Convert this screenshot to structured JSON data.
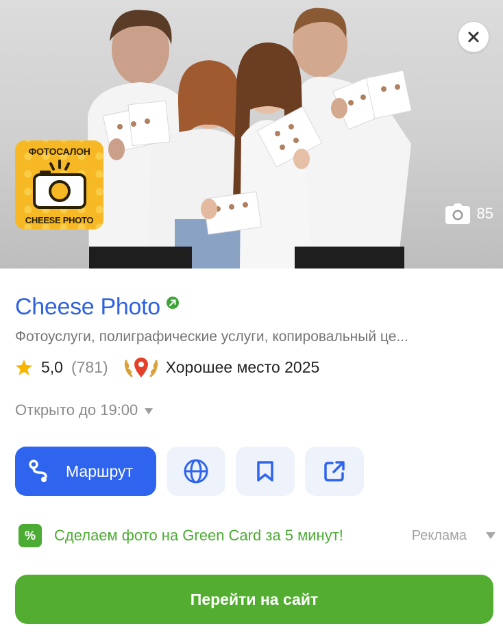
{
  "hero": {
    "logo": {
      "top_text": "ФОТОСАЛОН",
      "bottom_text": "CHEESE PHOTO",
      "color": "#f6b925"
    },
    "photo_count": "85",
    "close_icon": "close-icon",
    "camera_icon": "camera-icon"
  },
  "place": {
    "name": "Cheese Photo",
    "categories": "Фотоуслуги, полиграфические услуги, копировальный це...",
    "rating": "5,0",
    "reviews": "(781)",
    "award": "Хорошее место 2025",
    "hours": "Открыто до 19:00"
  },
  "actions": {
    "route_label": "Маршрут",
    "icons": [
      "globe-icon",
      "bookmark-icon",
      "share-icon"
    ]
  },
  "ad": {
    "text": "Сделаем фото на Green Card за 5 минут!",
    "label": "Реклама",
    "cta": "Перейти на сайт"
  },
  "colors": {
    "link_blue": "#2e62e0",
    "route_blue": "#2e64ee",
    "ad_green": "#4cab33",
    "cta_green": "#52ad30",
    "icon_button_bg": "#eef2fa"
  }
}
